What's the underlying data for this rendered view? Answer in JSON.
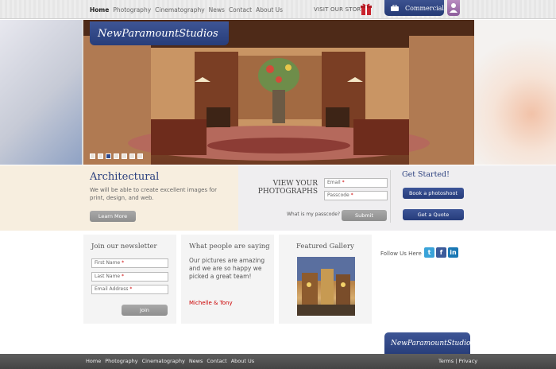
{
  "nav": {
    "items": [
      "Home",
      "Photography",
      "Cinematography",
      "News",
      "Contact",
      "About Us"
    ],
    "active": "Home"
  },
  "store_label": "VISIT OUR STORE",
  "commercial_label": "Commercial",
  "logo_text": "NewParamountStudios",
  "hero": {
    "slide_count": 7,
    "active_slide": 3
  },
  "architectural": {
    "title": "Architectural",
    "description": "We will be able to create excellent images for print, design, and web.",
    "learn_more": "Learn More"
  },
  "login": {
    "heading_line1": "VIEW YOUR",
    "heading_line2": "PHOTOGRAPHS",
    "email_placeholder": "Email",
    "passcode_placeholder": "Passcode",
    "passcode_help": "What is my passcode?",
    "submit": "Submit"
  },
  "get_started": {
    "title": "Get Started!",
    "book": "Book a photoshoot",
    "quote": "Get a Quote"
  },
  "newsletter": {
    "title": "Join our newsletter",
    "first_name": "First Name",
    "last_name": "Last Name",
    "email": "Email Address",
    "join": "Join"
  },
  "testimonial": {
    "title": "What people are saying",
    "quote": "Our pictures are amazing and we are so happy we picked a great team!",
    "author": "Michelle & Tony"
  },
  "gallery": {
    "title": "Featured Gallery"
  },
  "social": {
    "follow_label": "Follow Us Here",
    "networks": [
      "twitter",
      "facebook",
      "linkedin"
    ]
  },
  "footer": {
    "nav": [
      "Home",
      "Photography",
      "Cinematography",
      "News",
      "Contact",
      "About Us"
    ],
    "terms": "Terms",
    "privacy": "Privacy",
    "separator": "|"
  },
  "colors": {
    "brand_blue": "#2a3f7e",
    "required": "#cc0000",
    "footer": "#4a4a4a"
  }
}
